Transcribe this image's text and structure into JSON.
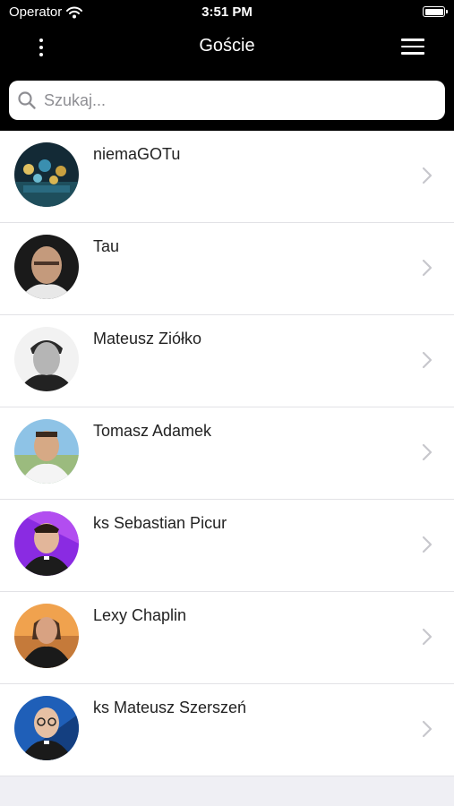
{
  "status_bar": {
    "carrier": "Operator",
    "time": "3:51 PM",
    "wifi_icon": "wifi-icon",
    "battery_level": 1.0
  },
  "nav": {
    "title": "Goście",
    "left_icon": "more-vertical-icon",
    "right_icon": "hamburger-menu-icon"
  },
  "search": {
    "placeholder": "Szukaj...",
    "value": "",
    "icon": "search-icon"
  },
  "guests": [
    {
      "name": "niemaGOTu",
      "avatar": "concert-crowd-photo"
    },
    {
      "name": "Tau",
      "avatar": "portrait-photo"
    },
    {
      "name": "Mateusz Ziółko",
      "avatar": "portrait-photo"
    },
    {
      "name": "Tomasz Adamek",
      "avatar": "portrait-photo"
    },
    {
      "name": "ks Sebastian Picur",
      "avatar": "portrait-photo"
    },
    {
      "name": "Lexy Chaplin",
      "avatar": "portrait-photo"
    },
    {
      "name": "ks Mateusz Szerszeń",
      "avatar": "portrait-photo"
    }
  ],
  "colors": {
    "header_bg": "#000000",
    "list_bg": "#ffffff",
    "page_bg": "#efeff4",
    "chevron": "#c7c7cc",
    "separator": "#e2e2e6"
  }
}
